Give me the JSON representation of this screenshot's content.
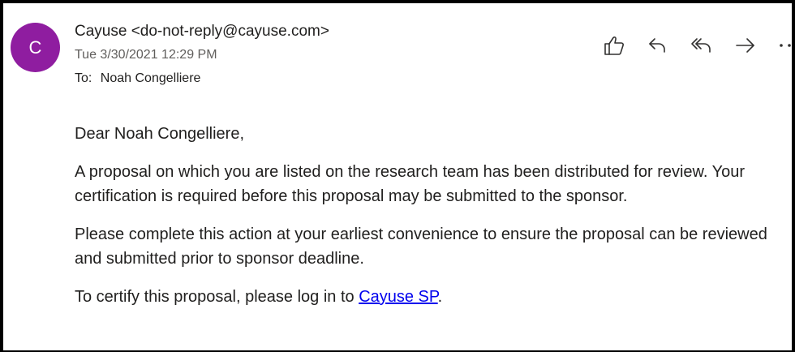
{
  "header": {
    "avatar_initial": "C",
    "avatar_color": "#8f1da0",
    "sender": "Cayuse <do-not-reply@cayuse.com>",
    "date": "Tue 3/30/2021 12:29 PM",
    "to_label": "To:",
    "to_value": "Noah Congelliere"
  },
  "actions": [
    {
      "name": "like",
      "icon": "thumbs-up-icon"
    },
    {
      "name": "reply",
      "icon": "reply-icon"
    },
    {
      "name": "reply-all",
      "icon": "reply-all-icon"
    },
    {
      "name": "forward",
      "icon": "forward-icon"
    },
    {
      "name": "more",
      "icon": "more-icon"
    }
  ],
  "message": {
    "greeting": "Dear Noah Congelliere,",
    "paragraph1": "A proposal on which you are listed on the research team has been distributed for review. Your certification is required before this proposal may be submitted to the sponsor.",
    "paragraph2": "Please complete this action at your earliest convenience to ensure the proposal can be reviewed and submitted prior to sponsor deadline.",
    "certify_prefix": "To certify this proposal, please log in to ",
    "certify_link": "Cayuse SP",
    "certify_suffix": "."
  }
}
